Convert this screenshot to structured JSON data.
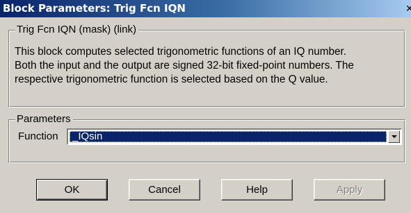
{
  "window": {
    "title": "Block Parameters: Trig Fcn IQN",
    "close_glyph": "✕"
  },
  "description_group": {
    "legend": "Trig Fcn IQN (mask) (link)",
    "lines": [
      "This block computes selected trigonometric functions of an IQ number.",
      "Both the input and the output are signed 32-bit fixed-point numbers. The",
      "respective trigonometric function is selected based on the Q value."
    ]
  },
  "parameters_group": {
    "legend": "Parameters",
    "function_label": "Function",
    "function_value": "_IQsin"
  },
  "buttons": {
    "ok": "OK",
    "cancel": "Cancel",
    "help": "Help",
    "apply": "Apply"
  },
  "icons": {
    "close": "close-icon",
    "dropdown": "chevron-down-icon"
  },
  "colors": {
    "title_active": "#0a246a",
    "face": "#d4d0c8",
    "selection": "#0a246a"
  }
}
